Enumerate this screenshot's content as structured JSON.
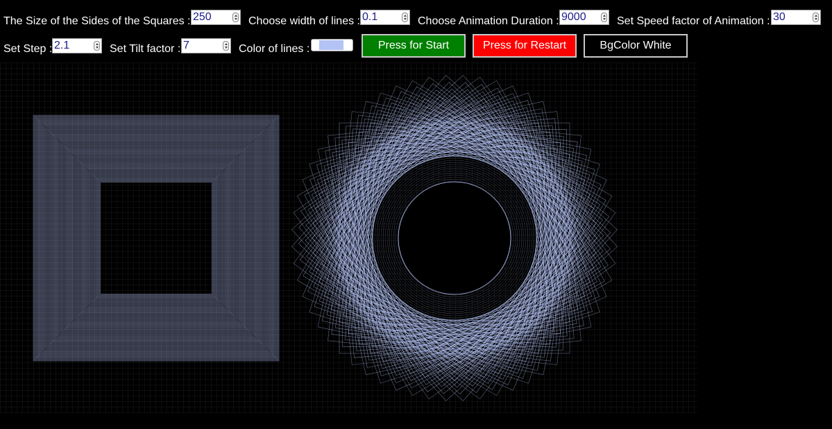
{
  "controls": {
    "size": {
      "label": "The Size of the Sides of the Squares :",
      "value": "250"
    },
    "width": {
      "label": "Choose width of lines :",
      "value": "0.1"
    },
    "duration": {
      "label": "Choose Animation Duration :",
      "value": "9000"
    },
    "speed": {
      "label": "Set Speed factor of Animation :",
      "value": "30"
    },
    "step": {
      "label": "Set Step :",
      "value": "2.1"
    },
    "tilt": {
      "label": "Set Tilt factor :",
      "value": "7"
    },
    "color": {
      "label": "Color of lines :",
      "value": "#b4c3f5"
    }
  },
  "buttons": {
    "start": {
      "label": "Press for Start",
      "color": "#008000"
    },
    "restart": {
      "label": "Press for Restart",
      "color": "#ff0000"
    },
    "bgcolor": {
      "label": "BgColor White",
      "color": "#000000"
    }
  },
  "canvas": {
    "background": "#000000",
    "grid_color": "#1a1a1a",
    "line_color": "#b4c3f5"
  }
}
